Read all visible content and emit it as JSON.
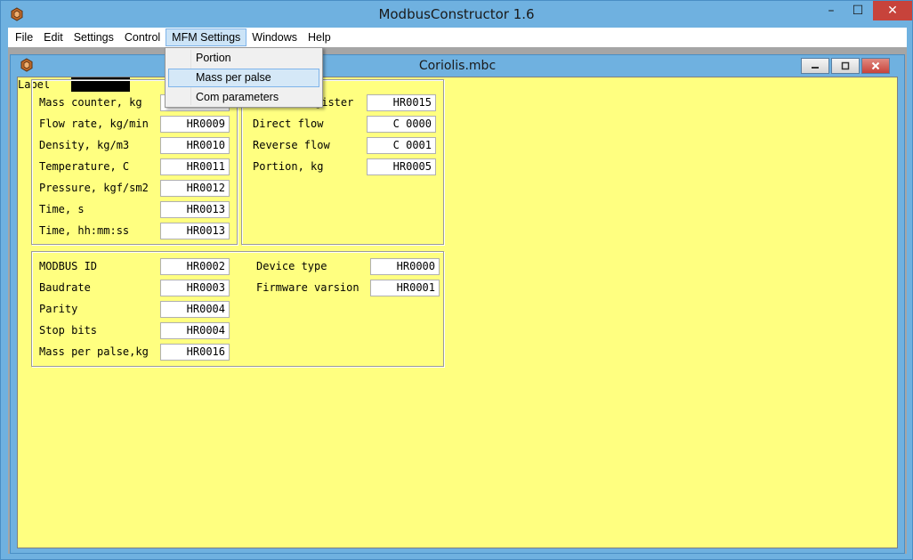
{
  "app": {
    "title": "ModbusConstructor 1.6",
    "close_glyph": "✕",
    "minimize_glyph": "–",
    "maximize_glyph": "☐"
  },
  "menubar": {
    "items": [
      "File",
      "Edit",
      "Settings",
      "Control",
      "MFM Settings",
      "Windows",
      "Help"
    ],
    "active": "MFM Settings"
  },
  "dropdown": {
    "items": [
      "Portion",
      "Mass per palse",
      "Com parameters"
    ],
    "hover": "Mass per palse"
  },
  "child": {
    "title": "Coriolis.mbc"
  },
  "form": {
    "label_caption": "Label",
    "group1": [
      {
        "label": "Mass counter, kg",
        "value": ""
      },
      {
        "label": "Flow rate, kg/min",
        "value": "HR0009"
      },
      {
        "label": "Density, kg/m3",
        "value": "HR0010"
      },
      {
        "label": "Temperature, C",
        "value": "HR0011"
      },
      {
        "label": "Pressure, kgf/sm2",
        "value": "HR0012"
      },
      {
        "label": "Time, s",
        "value": "HR0013"
      },
      {
        "label": "Time, hh:mm:ss",
        "value": "HR0013"
      }
    ],
    "group2": [
      {
        "label": "gister",
        "value": "HR0015"
      },
      {
        "label": "Direct flow",
        "value": "C 0000"
      },
      {
        "label": "Reverse flow",
        "value": "C 0001"
      },
      {
        "label": "Portion, kg",
        "value": "HR0005"
      }
    ],
    "group3": [
      {
        "label": "MODBUS ID",
        "value": "HR0002"
      },
      {
        "label": "Baudrate",
        "value": "HR0003"
      },
      {
        "label": "Parity",
        "value": "HR0004"
      },
      {
        "label": "Stop bits",
        "value": "HR0004"
      },
      {
        "label": "Mass per palse,kg",
        "value": "HR0016"
      }
    ],
    "group4": [
      {
        "label": "Device type",
        "value": "HR0000"
      },
      {
        "label": "Firmware varsion",
        "value": "HR0001"
      }
    ]
  },
  "colors": {
    "client_bg": "#ffff80",
    "frame": "#6fb1e0",
    "close": "#c7433b"
  }
}
